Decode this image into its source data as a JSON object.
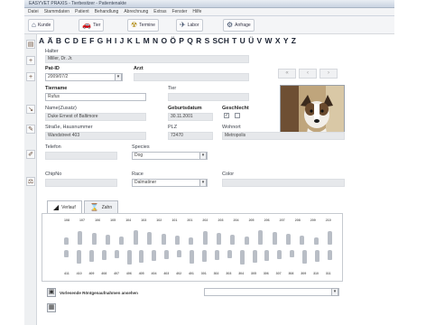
{
  "window": {
    "title": "EASYVET PRAXIS - Tierbesitzer - Patientenakte"
  },
  "menu": [
    "Datei",
    "Stammdaten",
    "Patient",
    "Behandlung",
    "Abrechnung",
    "Extras",
    "Fenster",
    "Hilfe"
  ],
  "toolbar": [
    {
      "label": "Kunde",
      "icon": "home-icon"
    },
    {
      "label": "Tier",
      "icon": "car-icon"
    },
    {
      "label": "Termine",
      "icon": "biohazard-icon"
    },
    {
      "label": "Labor",
      "icon": "airplane-icon"
    },
    {
      "label": "Anfrage",
      "icon": "gear-icon"
    }
  ],
  "alphabet": [
    "A",
    "Ä",
    "B",
    "C",
    "D",
    "E",
    "F",
    "G",
    "H",
    "I",
    "J",
    "K",
    "L",
    "M",
    "N",
    "O",
    "Ö",
    "P",
    "Q",
    "R",
    "S",
    "SCH",
    "T",
    "U",
    "Ü",
    "V",
    "W",
    "X",
    "Y",
    "Z"
  ],
  "form": {
    "halter_label": "Halter",
    "halter_value": "Miller, Dr. Jr.",
    "patid_label": "Pat-ID",
    "patid_value": "2009/07/2",
    "arzt_label": "Arzt",
    "tiername_label": "Tiername",
    "tiername_value": "Rufus",
    "tier_label": "Tier",
    "owner_label": "Name(Zusatz)",
    "owner_value": "Duke Ernest of Baltimore",
    "geburt_label": "Geburtsdatum",
    "geburt_value": "30.11.2001",
    "geschlecht_label": "Geschlecht",
    "strasse_label": "Straße, Hausnummer",
    "strasse_value": "Wandstreet 403",
    "plz_label": "PLZ",
    "plz_value": "72470",
    "wohnort_label": "Wohnort",
    "wohnort_value": "Metropolis",
    "telefon_label": "Telefon",
    "species_label": "Species",
    "species_value": "Dog",
    "chipnr_label": "ChipNo",
    "race_label": "Race",
    "race_value": "Dalmatiner",
    "color_label": "Color"
  },
  "tabs": [
    {
      "label": "Verlauf",
      "icon": "dog-icon"
    },
    {
      "label": "Zahn",
      "icon": "hourglass-icon"
    }
  ],
  "dental": {
    "upper_numbers": [
      "108",
      "107",
      "106",
      "105",
      "104",
      "103",
      "102",
      "101",
      "201",
      "202",
      "203",
      "204",
      "205",
      "206",
      "207",
      "208",
      "209",
      "210"
    ],
    "lower_numbers": [
      "411",
      "410",
      "409",
      "408",
      "407",
      "406",
      "405",
      "404",
      "403",
      "402",
      "401",
      "301",
      "302",
      "303",
      "304",
      "305",
      "306",
      "307",
      "308",
      "309",
      "310",
      "311"
    ]
  },
  "bottom": {
    "label": "Vorlesende Röntgenaufnahmen ansehen"
  }
}
